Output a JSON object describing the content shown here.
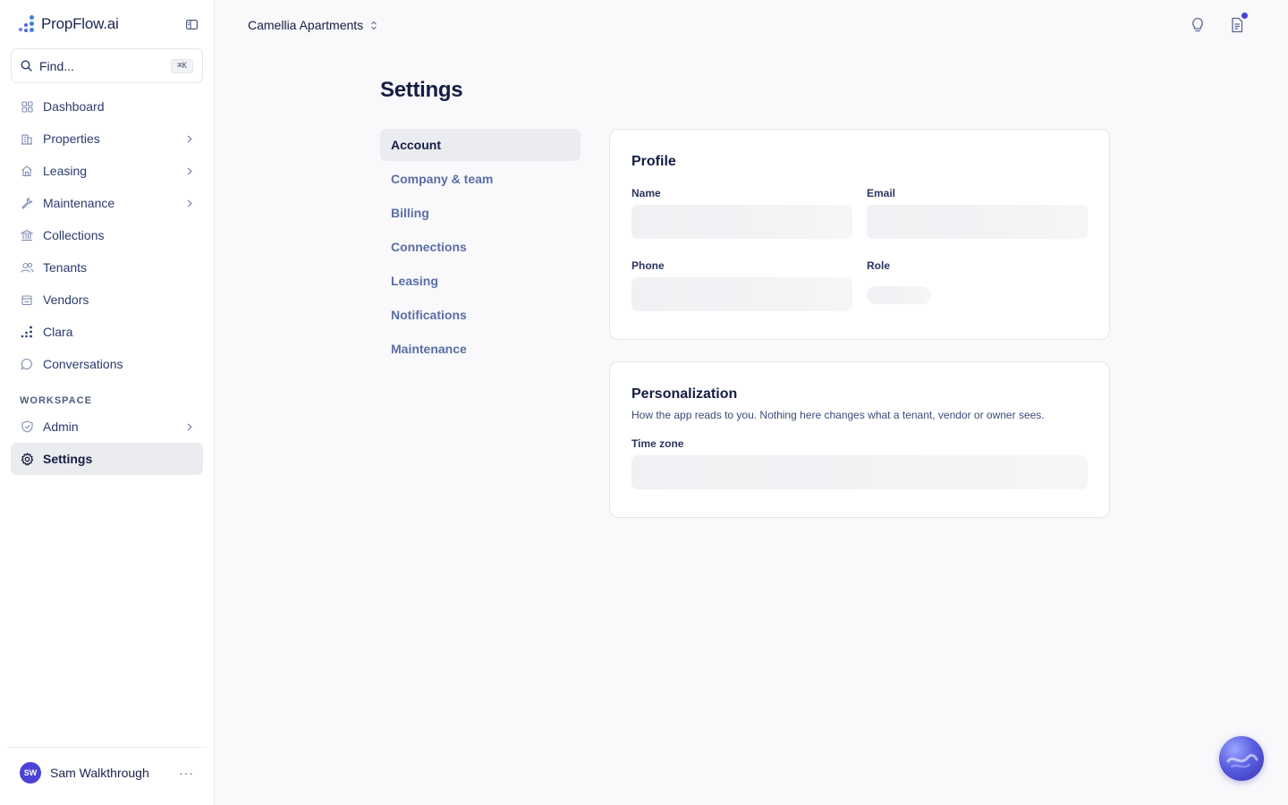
{
  "brand": {
    "name": "PropFlow.ai"
  },
  "search": {
    "label": "Find...",
    "shortcut": "⌘K"
  },
  "nav": {
    "items": [
      {
        "label": "Dashboard",
        "icon": "grid-icon"
      },
      {
        "label": "Properties",
        "icon": "building-icon"
      },
      {
        "label": "Leasing",
        "icon": "home-icon"
      },
      {
        "label": "Maintenance",
        "icon": "wrench-icon"
      },
      {
        "label": "Collections",
        "icon": "bank-icon"
      },
      {
        "label": "Tenants",
        "icon": "users-icon"
      },
      {
        "label": "Vendors",
        "icon": "store-icon"
      },
      {
        "label": "Clara",
        "icon": "sparkle-dots-icon"
      },
      {
        "label": "Conversations",
        "icon": "chat-icon"
      }
    ],
    "section_label": "WORKSPACE",
    "workspace_items": [
      {
        "label": "Admin",
        "icon": "shield-icon"
      },
      {
        "label": "Settings",
        "icon": "gear-icon"
      }
    ]
  },
  "user": {
    "initials": "SW",
    "name": "Sam Walkthrough",
    "more": "···"
  },
  "header": {
    "property": "Camellia Apartments"
  },
  "page": {
    "title": "Settings"
  },
  "subnav": {
    "items": [
      "Account",
      "Company & team",
      "Billing",
      "Connections",
      "Leasing",
      "Notifications",
      "Maintenance"
    ]
  },
  "profile": {
    "title": "Profile",
    "name_label": "Name",
    "email_label": "Email",
    "phone_label": "Phone",
    "role_label": "Role"
  },
  "personalization": {
    "title": "Personalization",
    "description": "How the app reads to you. Nothing here changes what a tenant, vendor or owner sees.",
    "timezone_label": "Time zone"
  },
  "colors": {
    "accent": "#4a43d6",
    "text": "#1e2a55",
    "subnav_text": "#5a6ea5"
  }
}
